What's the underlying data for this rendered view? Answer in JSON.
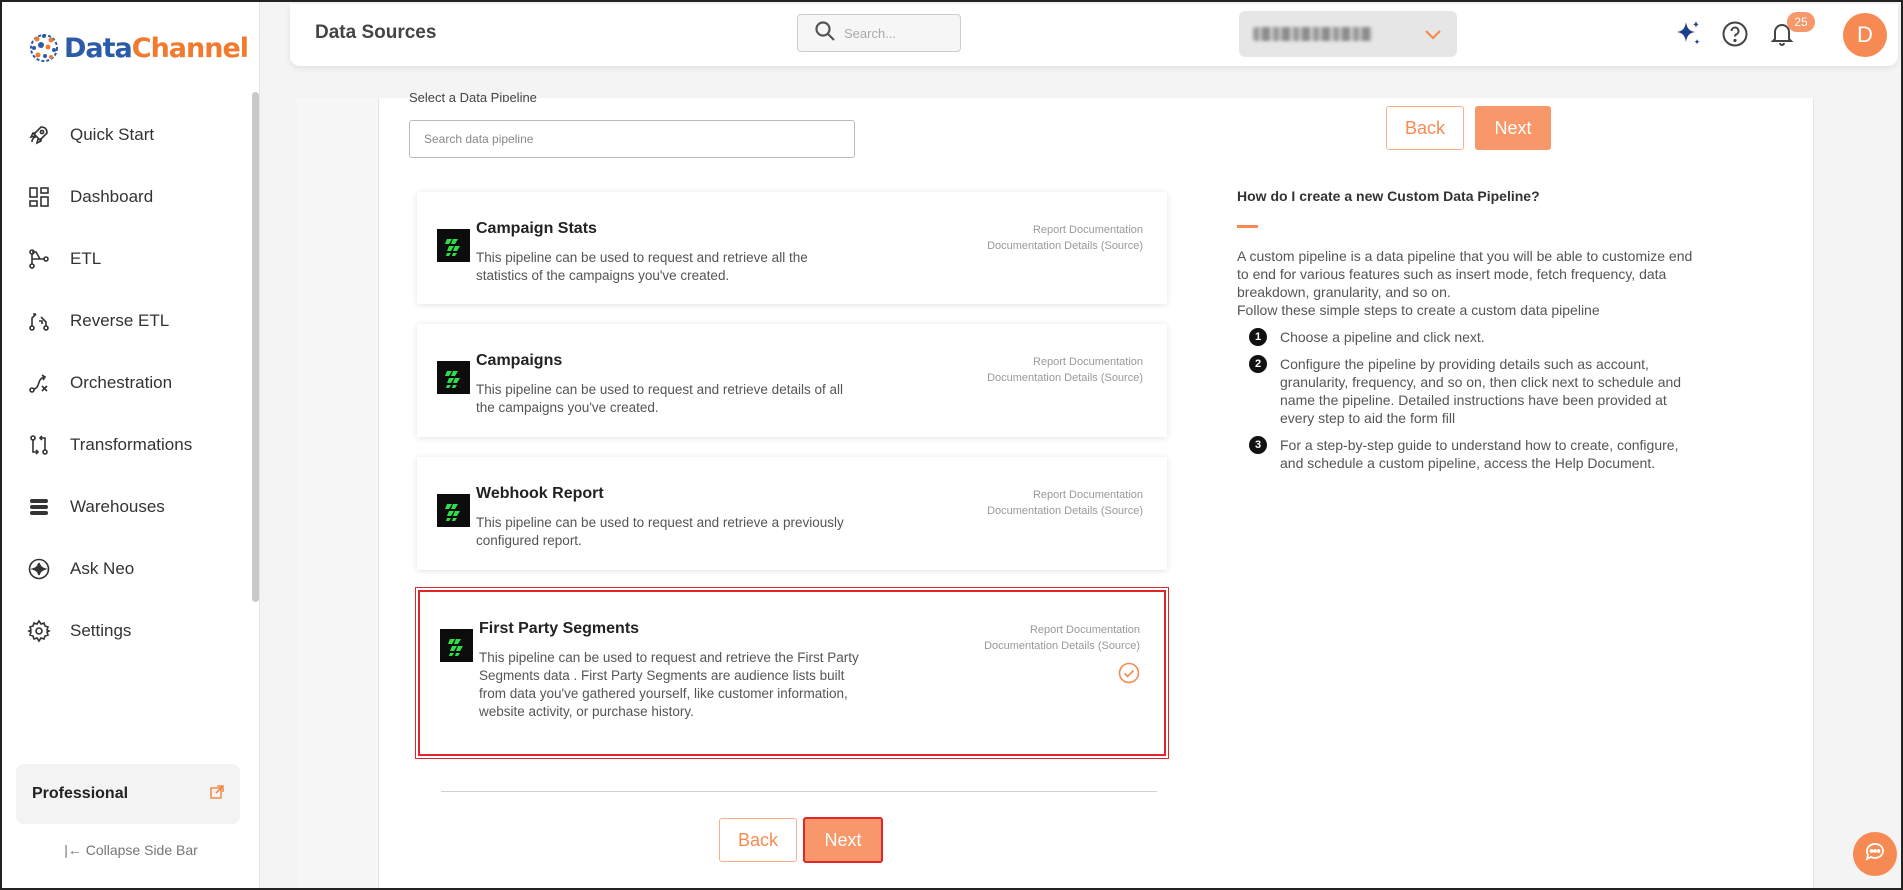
{
  "brand": {
    "name_part1": "Data",
    "name_part2": "Channel"
  },
  "sidebar": {
    "items": [
      {
        "label": "Quick Start",
        "icon": "rocket-icon"
      },
      {
        "label": "Dashboard",
        "icon": "dashboard-icon"
      },
      {
        "label": "ETL",
        "icon": "etl-icon"
      },
      {
        "label": "Reverse ETL",
        "icon": "reverse-etl-icon"
      },
      {
        "label": "Orchestration",
        "icon": "orchestration-icon"
      },
      {
        "label": "Transformations",
        "icon": "transformations-icon"
      },
      {
        "label": "Warehouses",
        "icon": "warehouses-icon"
      },
      {
        "label": "Ask Neo",
        "icon": "ask-neo-icon"
      },
      {
        "label": "Settings",
        "icon": "gear-icon"
      }
    ],
    "plan_label": "Professional",
    "collapse_label": "Collapse Side Bar"
  },
  "header": {
    "title": "Data Sources",
    "search_placeholder": "Search...",
    "notifications_count": "25",
    "avatar_initial": "D"
  },
  "main": {
    "select_label": "Select a Data Pipeline",
    "pipeline_search_placeholder": "Search data pipeline",
    "back_label": "Back",
    "next_label": "Next",
    "link_report": "Report Documentation",
    "link_details": "Documentation Details (Source)",
    "pipelines": [
      {
        "title": "Campaign Stats",
        "description": "This pipeline can be used to request and retrieve all the statistics of the campaigns you've created.",
        "selected": false
      },
      {
        "title": "Campaigns",
        "description": "This pipeline can be used to request and retrieve details of all the campaigns you've created.",
        "selected": false
      },
      {
        "title": "Webhook Report",
        "description": "This pipeline can be used to request and retrieve a previously configured report.",
        "selected": false
      },
      {
        "title": "First Party Segments",
        "description": "This pipeline can be used to request and retrieve the First Party Segments data . First Party Segments are audience lists built from data you've gathered yourself, like customer information, website activity, or purchase history.",
        "selected": true
      }
    ]
  },
  "help": {
    "title": "How do I create a new Custom Data Pipeline?",
    "intro": "A custom pipeline is a data pipeline that you will be able to customize end to end for various features such as insert mode, fetch frequency, data breakdown, granularity, and so on.",
    "intro2": "Follow these simple steps to create a custom data pipeline",
    "steps": [
      {
        "num": "1",
        "text": "Choose a pipeline and click next."
      },
      {
        "num": "2",
        "text": "Configure the pipeline by providing details such as account, granularity, frequency, and so on, then click next to schedule and name the pipeline. Detailed instructions have been provided at every step to aid the form fill"
      },
      {
        "num": "3",
        "text": "For a step-by-step guide to understand how to create, configure, and schedule a custom pipeline, access the Help Document."
      }
    ]
  },
  "colors": {
    "accent": "#f7976a",
    "brand_blue": "#2a5ba8",
    "brand_orange": "#f27a2e",
    "selected_border": "#e0262b"
  }
}
